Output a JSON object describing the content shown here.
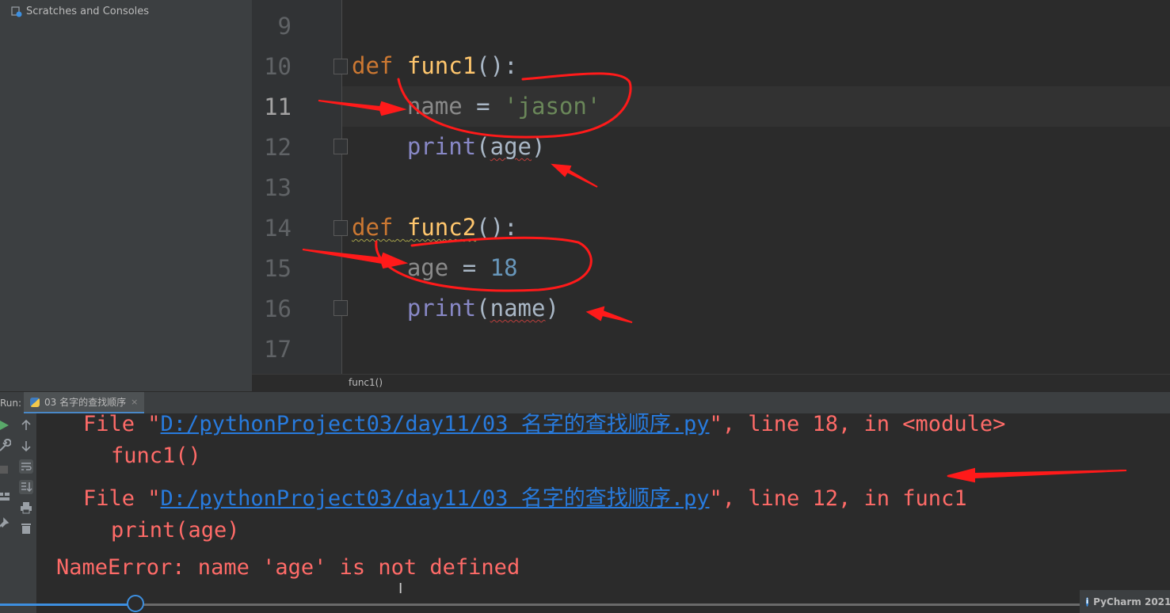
{
  "sidebar": {
    "scratches_label": "Scratches and Consoles"
  },
  "editor": {
    "line_numbers": [
      "9",
      "10",
      "11",
      "12",
      "13",
      "14",
      "15",
      "16",
      "17"
    ],
    "current_line": "11",
    "breadcrumb": "func1()",
    "code": {
      "l10_kw": "def",
      "l10_fn": "func1",
      "l10_rest": "():",
      "l11_name": "name",
      "l11_op": " = ",
      "l11_str": "'jason'",
      "l12_print": "print",
      "l12_open": "(",
      "l12_arg": "age",
      "l12_close": ")",
      "l14_kw": "def",
      "l14_fn": "func2",
      "l14_rest": "():",
      "l15_name": "age",
      "l15_op": " = ",
      "l15_num": "18",
      "l16_print": "print",
      "l16_open": "(",
      "l16_arg": "name",
      "l16_close": ")"
    }
  },
  "run_panel": {
    "label": "Run:",
    "tab_title": "03 名字的查找顺序",
    "tab_close": "×",
    "console": {
      "line1_prefix": "File \"",
      "line1_link": "D:/pythonProject03/day11/03 名字的查找顺序.py",
      "line1_suffix": "\", line 18, in <module>",
      "line2": "func1()",
      "line3_prefix": "File \"",
      "line3_link": "D:/pythonProject03/day11/03 名字的查找顺序.py",
      "line3_suffix": "\", line 12, in func1",
      "line4": "print(age)",
      "line5": "NameError: name 'age' is not defined"
    }
  },
  "notification": {
    "text": "PyCharm 2021"
  },
  "colors": {
    "annotation": "#ff1a1a",
    "keyword": "#cc7832",
    "function": "#ffc66d",
    "error": "#ff6b68",
    "link": "#287bde"
  },
  "icons": {
    "scratches": "scratches-icon",
    "run": "run-icon",
    "wrench": "wrench-icon",
    "stop": "stop-icon",
    "layout": "layout-icon",
    "pin": "pin-icon",
    "up": "arrow-up-icon",
    "down": "arrow-down-icon",
    "wrap": "soft-wrap-icon",
    "scroll_end": "scroll-to-end-icon",
    "print": "print-icon",
    "trash": "trash-icon",
    "python": "python-file-icon",
    "info": "info-icon"
  }
}
